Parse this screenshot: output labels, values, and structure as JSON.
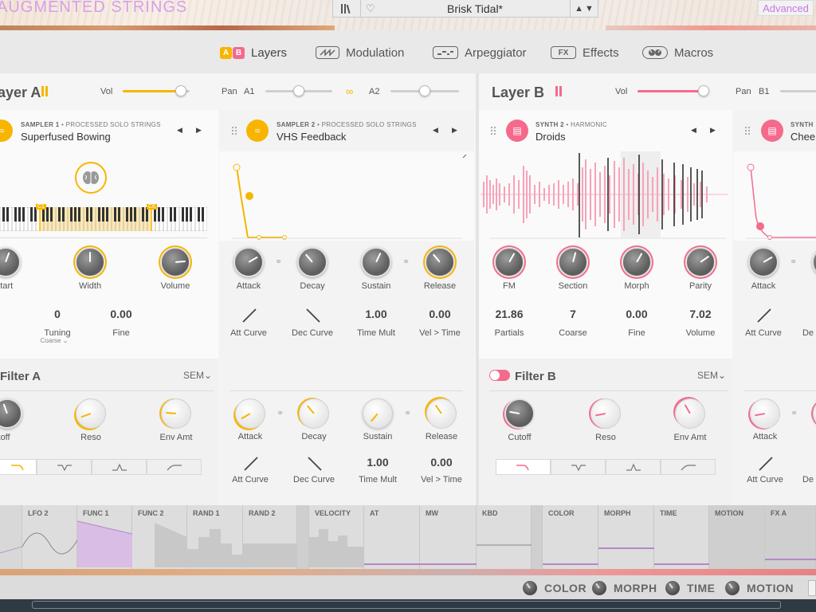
{
  "app": {
    "title": "AUGMENTED STRINGS",
    "preset_name": "Brisk Tidal*",
    "advanced_label": "Advanced"
  },
  "nav": {
    "tabs": [
      {
        "label": "Layers",
        "icon": "ab-layers-icon",
        "icon_text_a": "A",
        "icon_text_b": "B"
      },
      {
        "label": "Modulation",
        "icon": "modulation-wave-icon"
      },
      {
        "label": "Arpeggiator",
        "icon": "arpeggiator-icon"
      },
      {
        "label": "Effects",
        "icon": "fx-icon",
        "icon_text": "FX"
      },
      {
        "label": "Macros",
        "icon": "macros-icon"
      }
    ]
  },
  "colors": {
    "layer_a": "#f7b500",
    "layer_b": "#f56a8c",
    "title_purple": "#d6a0e8",
    "advanced_purple": "#c779e0"
  },
  "layerA": {
    "title": "ayer A",
    "vol_label": "Vol",
    "vol_level": 0.82,
    "pan_label": "Pan",
    "a1_label": "A1",
    "a2_label": "A2",
    "a1_level": 0.5,
    "a2_level": 0.5,
    "sampler1": {
      "type": "SAMPLER 1",
      "subtype": "PROCESSED SOLO STRINGS",
      "name": "Superfused Bowing",
      "range_low": "C1",
      "range_high": "C6",
      "knobs": [
        {
          "label": "d Start"
        },
        {
          "label": "Width"
        },
        {
          "label": "Volume"
        }
      ],
      "values": [
        {
          "value": "0",
          "label": "Tuning",
          "sub": "Coarse"
        },
        {
          "value": "0.00",
          "label": "Fine"
        }
      ]
    },
    "sampler2": {
      "type": "SAMPLER 2",
      "subtype": "PROCESSED SOLO STRINGS",
      "name": "VHS Feedback",
      "knobs": [
        {
          "label": "Attack"
        },
        {
          "label": "Decay"
        },
        {
          "label": "Sustain"
        },
        {
          "label": "Release"
        }
      ],
      "values": [
        {
          "value": "",
          "label": "Att Curve"
        },
        {
          "value": "",
          "label": "Dec Curve"
        },
        {
          "value": "1.00",
          "label": "Time Mult"
        },
        {
          "value": "0.00",
          "label": "Vel > Time"
        }
      ]
    },
    "filter": {
      "title": "Filter A",
      "type": "SEM",
      "knobs": [
        {
          "label": "utoff"
        },
        {
          "label": "Reso"
        },
        {
          "label": "Env Amt"
        }
      ]
    },
    "filter_env": {
      "knobs": [
        {
          "label": "Attack"
        },
        {
          "label": "Decay"
        },
        {
          "label": "Sustain"
        },
        {
          "label": "Release"
        }
      ],
      "values": [
        {
          "value": "",
          "label": "Att Curve"
        },
        {
          "value": "",
          "label": "Dec Curve"
        },
        {
          "value": "1.00",
          "label": "Time Mult"
        },
        {
          "value": "0.00",
          "label": "Vel > Time"
        }
      ]
    }
  },
  "layerB": {
    "title": "Layer B",
    "vol_label": "Vol",
    "vol_level": 0.9,
    "pan_label": "Pan",
    "b1_label": "B1",
    "synth": {
      "type": "SYNTH 2",
      "subtype": "HARMONIC",
      "name": "Droids",
      "knobs": [
        {
          "label": "FM"
        },
        {
          "label": "Section"
        },
        {
          "label": "Morph"
        },
        {
          "label": "Parity"
        }
      ],
      "values": [
        {
          "value": "21.86",
          "label": "Partials"
        },
        {
          "value": "7",
          "label": "Coarse"
        },
        {
          "value": "0.00",
          "label": "Fine"
        },
        {
          "value": "7.02",
          "label": "Volume"
        }
      ]
    },
    "synth_next": {
      "type": "SYNTH",
      "name": "Chee",
      "knobs": [
        {
          "label": "Attack"
        }
      ],
      "values": [
        {
          "label": "Att Curve"
        },
        {
          "label": "De"
        }
      ]
    },
    "filter": {
      "title": "Filter B",
      "type": "SEM",
      "knobs": [
        {
          "label": "Cutoff"
        },
        {
          "label": "Reso"
        },
        {
          "label": "Env Amt"
        }
      ]
    },
    "filter_env": {
      "knobs": [
        {
          "label": "Attack"
        }
      ],
      "values": [
        {
          "label": "Att Curve"
        },
        {
          "label": "De"
        }
      ]
    }
  },
  "mod_sources": [
    "LFO 2",
    "FUNC 1",
    "FUNC 2",
    "RAND 1",
    "RAND 2",
    "VELOCITY",
    "AT",
    "MW",
    "KBD",
    "COLOR",
    "MORPH",
    "TIME",
    "MOTION",
    "FX A"
  ],
  "macros": [
    "COLOR",
    "MORPH",
    "TIME",
    "MOTION"
  ]
}
